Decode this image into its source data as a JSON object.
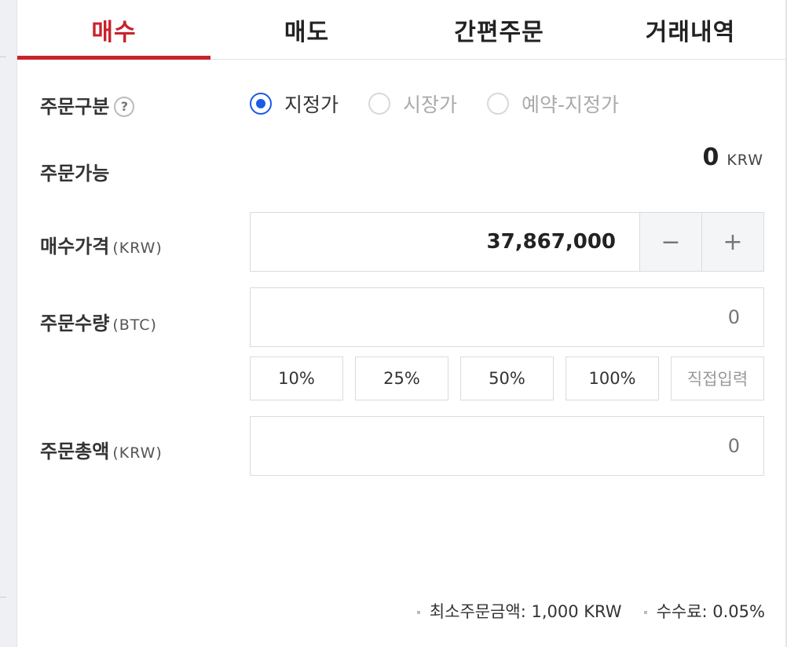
{
  "tabs": [
    {
      "label": "매수",
      "active": true
    },
    {
      "label": "매도",
      "active": false
    },
    {
      "label": "간편주문",
      "active": false
    },
    {
      "label": "거래내역",
      "active": false
    }
  ],
  "colors": {
    "accent_red": "#c8232c",
    "radio_blue": "#1b5be8"
  },
  "order_type": {
    "label": "주문구분",
    "help_icon": "?",
    "options": [
      {
        "label": "지정가",
        "selected": true
      },
      {
        "label": "시장가",
        "selected": false
      },
      {
        "label": "예약-지정가",
        "selected": false
      }
    ]
  },
  "available": {
    "label": "주문가능",
    "value": "0",
    "currency": "KRW"
  },
  "price": {
    "label": "매수가격",
    "unit": "(KRW)",
    "value": "37,867,000",
    "minus_icon": "−",
    "plus_icon": "+"
  },
  "quantity": {
    "label": "주문수량",
    "unit": "(BTC)",
    "placeholder": "0",
    "percent_buttons": [
      "10%",
      "25%",
      "50%",
      "100%"
    ],
    "direct_input": "직접입력"
  },
  "total": {
    "label": "주문총액",
    "unit": "(KRW)",
    "placeholder": "0"
  },
  "footer": {
    "min_order": "최소주문금액: 1,000 KRW",
    "fee": "수수료: 0.05%"
  }
}
